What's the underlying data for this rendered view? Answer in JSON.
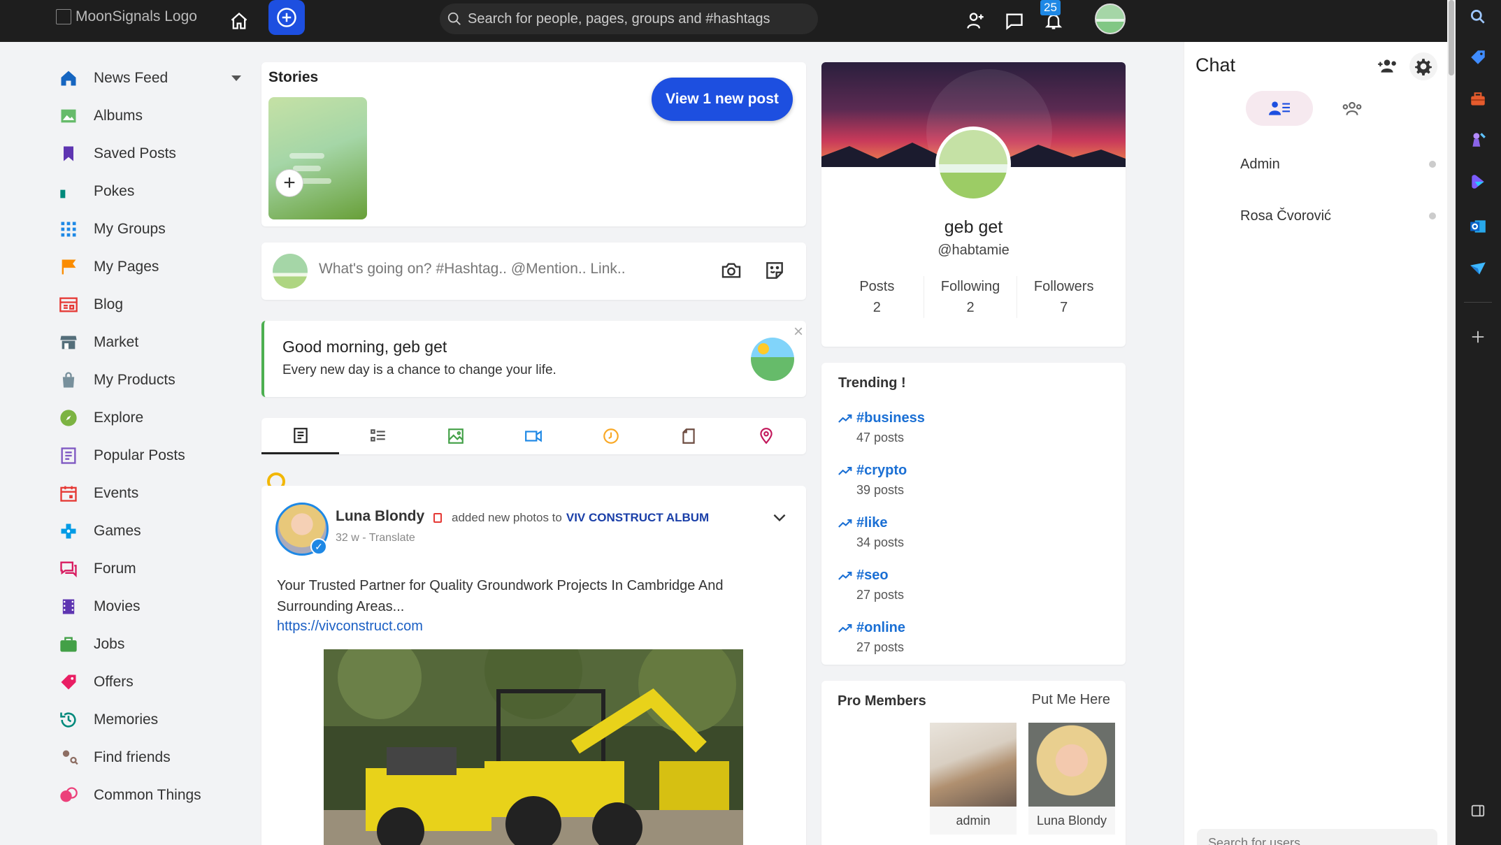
{
  "topbar": {
    "logo_alt": "MoonSignals Logo",
    "search_placeholder": "Search for people, pages, groups and #hashtags",
    "notification_count": "25"
  },
  "nav": {
    "items": [
      {
        "label": "News Feed",
        "icon": "home-icon",
        "color": "#1565c0"
      },
      {
        "label": "Albums",
        "icon": "albums-icon",
        "color": "#66bb6a"
      },
      {
        "label": "Saved Posts",
        "icon": "bookmark-icon",
        "color": "#5e35b1"
      },
      {
        "label": "Pokes",
        "icon": "poke-icon",
        "color": "#00897b"
      },
      {
        "label": "My Groups",
        "icon": "groups-icon",
        "color": "#1e88e5"
      },
      {
        "label": "My Pages",
        "icon": "flag-icon",
        "color": "#fb8c00"
      },
      {
        "label": "Blog",
        "icon": "blog-icon",
        "color": "#e53935"
      },
      {
        "label": "Market",
        "icon": "store-icon",
        "color": "#546e7a"
      },
      {
        "label": "My Products",
        "icon": "shopping-bag-icon",
        "color": "#78909c"
      },
      {
        "label": "Explore",
        "icon": "compass-icon",
        "color": "#7cb342"
      },
      {
        "label": "Popular Posts",
        "icon": "popular-posts-icon",
        "color": "#7e57c2"
      },
      {
        "label": "Events",
        "icon": "calendar-icon",
        "color": "#e53935"
      },
      {
        "label": "Games",
        "icon": "gamepad-icon",
        "color": "#039be5"
      },
      {
        "label": "Forum",
        "icon": "forum-icon",
        "color": "#d81b60"
      },
      {
        "label": "Movies",
        "icon": "film-icon",
        "color": "#5e35b1"
      },
      {
        "label": "Jobs",
        "icon": "briefcase-icon",
        "color": "#43a047"
      },
      {
        "label": "Offers",
        "icon": "tag-icon",
        "color": "#e91e63"
      },
      {
        "label": "Memories",
        "icon": "history-icon",
        "color": "#00897b"
      },
      {
        "label": "Find friends",
        "icon": "find-friends-icon",
        "color": "#8d6e63"
      },
      {
        "label": "Common Things",
        "icon": "common-things-icon",
        "color": "#ec407a"
      }
    ]
  },
  "stories": {
    "title": "Stories",
    "new_post_button": "View 1 new post"
  },
  "composer": {
    "placeholder": "What's going on? #Hashtag.. @Mention.. Link.."
  },
  "greeting": {
    "title": "Good morning, geb get",
    "subtitle": "Every new day is a chance to change your life."
  },
  "post": {
    "author": "Luna Blondy",
    "action": "added new photos to",
    "album": "VIV CONSTRUCT ALBUM",
    "time": "32 w - Translate",
    "text": "Your Trusted Partner for Quality Groundwork Projects In Cambridge And Surrounding Areas...",
    "link": "https://vivconstruct.com"
  },
  "profile": {
    "name": "geb get",
    "handle": "@habtamie",
    "stats": [
      {
        "label": "Posts",
        "value": "2"
      },
      {
        "label": "Following",
        "value": "2"
      },
      {
        "label": "Followers",
        "value": "7"
      }
    ]
  },
  "trending": {
    "title": "Trending !",
    "items": [
      {
        "tag": "#business",
        "count": "47 posts"
      },
      {
        "tag": "#crypto",
        "count": "39 posts"
      },
      {
        "tag": "#like",
        "count": "34 posts"
      },
      {
        "tag": "#seo",
        "count": "27 posts"
      },
      {
        "tag": "#online",
        "count": "27 posts"
      }
    ]
  },
  "pro_members": {
    "title": "Pro Members",
    "put_me_here": "Put Me Here",
    "members": [
      {
        "name": "admin"
      },
      {
        "name": "Luna Blondy"
      }
    ]
  },
  "chat": {
    "title": "Chat",
    "users": [
      {
        "name": "Admin"
      },
      {
        "name": "Rosa Čvorović"
      }
    ],
    "search_placeholder": "Search for users"
  },
  "colors": {
    "accent": "#1d4fe0",
    "link": "#1a6fd4",
    "topbar": "#1e1e1e"
  }
}
